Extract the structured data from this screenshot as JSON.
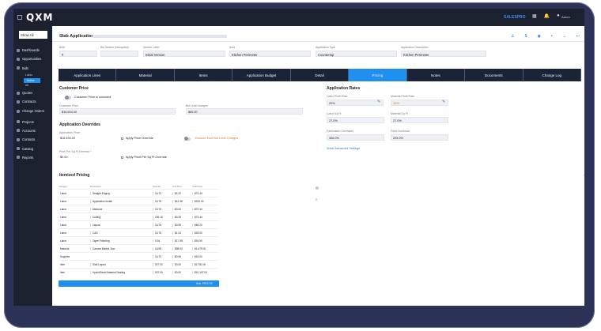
{
  "app": {
    "logo": "QXM",
    "brand_main": "SALES",
    "brand_accent": "PRO",
    "user": "Aaron"
  },
  "sidebar": {
    "show_all": "Show All",
    "items": [
      {
        "label": "Dashboards"
      },
      {
        "label": "Opportunities"
      },
      {
        "label": "Bids"
      },
      {
        "label": "Labor"
      },
      {
        "label": "Active"
      },
      {
        "label": "All"
      },
      {
        "label": "Quotes"
      },
      {
        "label": "Contracts"
      },
      {
        "label": "Change Orders"
      },
      {
        "label": "Projects"
      },
      {
        "label": "Accounts"
      },
      {
        "label": "Contacts"
      },
      {
        "label": "Catalog"
      },
      {
        "label": "Reports"
      }
    ]
  },
  "page": {
    "title": "Slab Application"
  },
  "fields": {
    "bid_label": "Bid#",
    "bid_value": "#",
    "bid_version_label": "Bid Version (Navigation)",
    "bid_version_value": "",
    "version_label_label": "Version Label",
    "version_label_value": "Initial Version",
    "area_label": "Area",
    "area_value": "Kitchen Perimeter",
    "application_type_label": "Application Type",
    "application_type_value": "Countertop",
    "application_description_label": "Application Description",
    "application_description_value": "Kitchen Perimeter"
  },
  "tabs": [
    {
      "label": "Application Lines"
    },
    {
      "label": "Material"
    },
    {
      "label": "Items"
    },
    {
      "label": "Application Budget"
    },
    {
      "label": "Detail"
    },
    {
      "label": "Pricing"
    },
    {
      "label": "Notes"
    },
    {
      "label": "Documents"
    },
    {
      "label": "Change Log"
    }
  ],
  "pricing": {
    "customer_price_title": "Customer Price",
    "customer_price_unlocked": "Customer Price is unlocked.",
    "customer_price_label": "Customer Price",
    "customer_price_value": "$16,504.00",
    "bid_level_charges_label": "Bid Level charges",
    "bid_level_charges_value": "$60.00",
    "overrides_title": "Application Overrides",
    "application_price_label": "Application Price",
    "application_price_value": "$16,494.00",
    "apply_price_override": "Apply Price Override",
    "exclude_bid_level": "Exclude from Bid Level Charges",
    "price_per_sqft_label": "Price Per Sq Ft Override *",
    "price_per_sqft_value": "$0.00",
    "apply_price_per_sqft": "Apply Price Per Sq Ft Override"
  },
  "rates": {
    "title": "Application Rates",
    "labor_profit_label": "Labor Profit Rate",
    "labor_profit_value": "20%",
    "material_profit_label": "Material Profit Rate",
    "material_profit_value": "20%",
    "labor_sqft_label": "Labor Sq Ft",
    "labor_sqft_value": "27.0%",
    "material_sqft_label": "Material Sq Ft",
    "material_sqft_value": "27.0%",
    "fabrication_overhead_label": "Fabrication Overhead",
    "fabrication_overhead_value": "306.0%",
    "field_overhead_label": "Field Overhead",
    "field_overhead_value": "225.0%",
    "show_advanced": "Show Advanced Settings"
  },
  "itemized": {
    "title": "Itemized Pricing",
    "headers": [
      "Category",
      "Description",
      "Quantity",
      "Unit Price",
      "Total Price"
    ],
    "rows": [
      [
        "Labor",
        "Straight Edging",
        "16.70",
        "$1.20",
        "$72.44"
      ],
      [
        "Labor",
        "Application Install",
        "16.78",
        "$12.38",
        "$232.00"
      ],
      [
        "Labor",
        "Measure",
        "16.78",
        "$3.94",
        "$72.34"
      ],
      [
        "Labor",
        "Cutting",
        "206.16",
        "$0.35",
        "$72.44"
      ],
      [
        "Labor",
        "Layout",
        "16.78",
        "$3.95",
        "$66.20"
      ],
      [
        "Labor",
        "CAD",
        "16.78",
        "$1.34",
        "$25.00"
      ],
      [
        "Labor",
        "Ogee Polishing",
        "0.94",
        "$17.98",
        "$16.90"
      ],
      [
        "Material",
        "Carrara Marble 3cm",
        "16.98",
        "$98.90",
        "$1,679.00"
      ],
      [
        "Supplies",
        "",
        "16.70",
        "$0.96",
        "$16.00"
      ],
      [
        "Item",
        "Slab Layout",
        "927.00",
        "$3.00",
        "$2,781.00"
      ],
      [
        "Item",
        "HydroShield Material Sealing",
        "927.00",
        "$3.00",
        "$10,197.00"
      ]
    ],
    "total": "Sub. PEO.75"
  },
  "colors": {
    "accent": "#1f8ff0",
    "nav_dark": "#1c2130",
    "warning": "#e1781b"
  }
}
